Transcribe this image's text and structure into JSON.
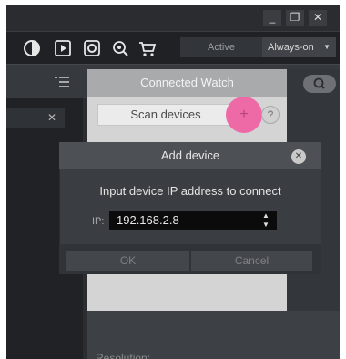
{
  "window": {
    "minimize_glyph": "_",
    "restore_glyph": "❐",
    "close_glyph": "✕"
  },
  "toolbar": {
    "icons": [
      "contrast-icon",
      "play-icon",
      "record-icon",
      "scan-icon",
      "cart-icon"
    ],
    "mode_active_label": "Active",
    "mode_selected": "Always-on"
  },
  "left_panel": {
    "close_glyph": "✕"
  },
  "watch_panel": {
    "title": "Connected Watch",
    "scan_label": "Scan devices",
    "add_glyph": "+",
    "help_glyph": "?",
    "resolution_label": "Resolution:"
  },
  "modal": {
    "title": "Add device",
    "close_glyph": "✕",
    "prompt": "Input device IP address to connect",
    "ip_label": "IP:",
    "ip_value": "192.168.2.8",
    "ok_label": "OK",
    "cancel_label": "Cancel"
  },
  "colors": {
    "accent_pink": "#ee6aa6",
    "panel_dark": "#2b2d30",
    "panel_light": "#d4d4d4"
  }
}
